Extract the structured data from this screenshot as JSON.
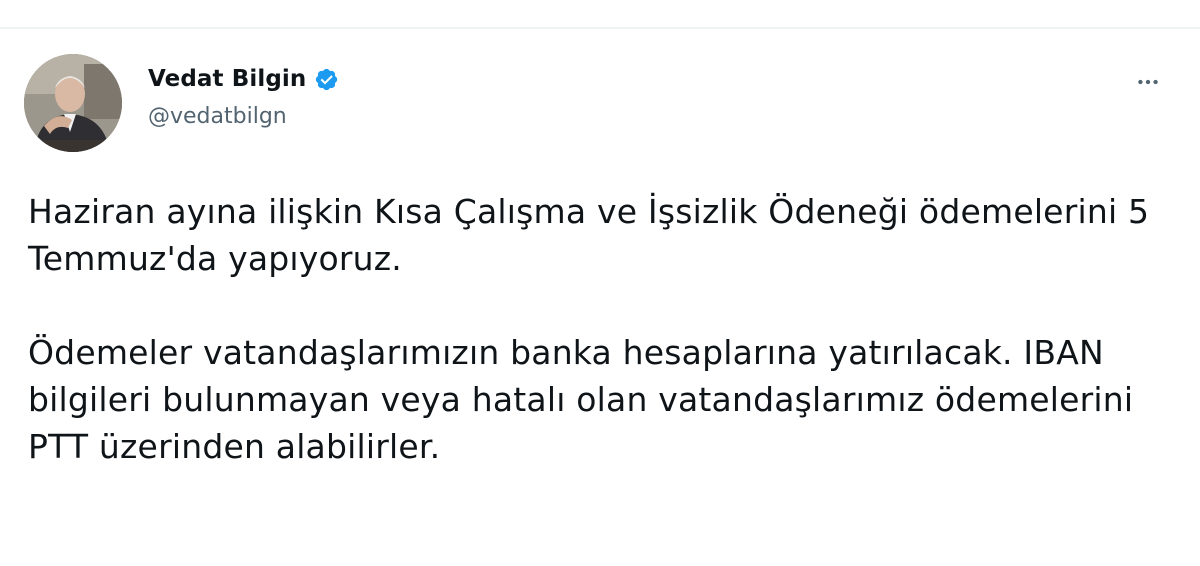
{
  "author": {
    "display_name": "Vedat Bilgin",
    "handle": "@vedatbilgn",
    "verified": true
  },
  "tweet": {
    "paragraphs": [
      "Haziran ayına ilişkin Kısa Çalışma ve İşsizlik Ödeneği ödemelerini 5 Temmuz'da yapıyoruz.",
      "Ödemeler vatandaşlarımızın banka hesaplarına yatırılacak. IBAN bilgileri bulunmayan veya hatalı olan vatandaşlarımız ödemelerini PTT üzerinden alabilirler."
    ]
  },
  "colors": {
    "verified_badge": "#1d9bf0",
    "secondary_text": "#536471",
    "primary_text": "#0f1419"
  },
  "icons": {
    "verified": "verified-badge-icon",
    "more": "more-options-icon"
  }
}
